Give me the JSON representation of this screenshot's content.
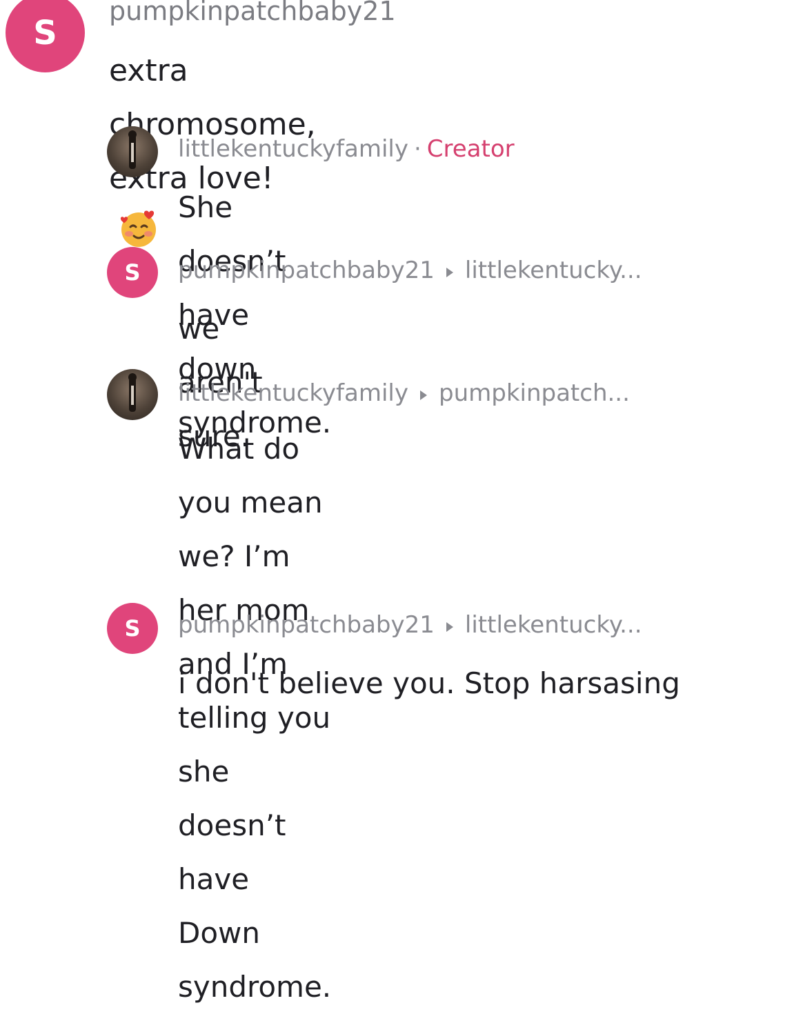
{
  "comments": [
    {
      "avatar_letter": "S",
      "username": "pumpkinpatchbaby21",
      "text": "extra chromosome, extra love!",
      "emoji": "smiling-face-with-hearts-emoji"
    },
    {
      "avatar_icon": "profile-photo-icon",
      "username": "littlekentuckyfamily",
      "separator": "·",
      "badge": "Creator",
      "text": "She doesn’t have down syndrome."
    },
    {
      "avatar_letter": "S",
      "username": "pumpkinpatchbaby21",
      "reply_to": "littlekentucky...",
      "text": "we aren't sure."
    },
    {
      "avatar_icon": "profile-photo-icon",
      "username": "littlekentuckyfamily",
      "reply_to": "pumpkinpatch...",
      "text_lines": [
        "What do you mean we? I’m her mom",
        "and I’m telling you she doesn’t have",
        "Down syndrome."
      ]
    },
    {
      "avatar_letter": "S",
      "username": "pumpkinpatchbaby21",
      "reply_to": "littlekentucky...",
      "text": "i don't believe you. Stop harsasing"
    }
  ],
  "colors": {
    "avatar_pink": "#e0457b",
    "creator_badge": "#d5406f",
    "meta_gray": "#8a8b91"
  }
}
